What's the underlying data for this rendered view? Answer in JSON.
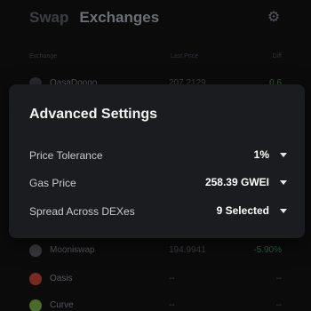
{
  "tabs": [
    {
      "label": "Swap"
    },
    {
      "label": "Exchanges"
    }
  ],
  "header": {
    "settings_icon": "gear-icon"
  },
  "table": {
    "columns": [
      "Exchange",
      "Last Price",
      "Diff"
    ],
    "rows": [
      {
        "name": "OasaDoogo",
        "price": "207.2129",
        "diff": "0.6",
        "logo_color": "#2b2c30"
      },
      {
        "name": "Mooniswap",
        "price": "194.9941",
        "diff": "-5.90%",
        "logo_color": "#3a3b40"
      },
      {
        "name": "Oasis",
        "price": "--",
        "diff": "--",
        "logo_color": "#7a2a20"
      },
      {
        "name": "Curve",
        "price": "--",
        "diff": "--",
        "logo_color": "#4a6b2a"
      }
    ]
  },
  "modal": {
    "title": "Advanced Settings",
    "settings": [
      {
        "label": "Price Tolerance",
        "value": "1%"
      },
      {
        "label": "Gas Price",
        "value": "258.39 GWEI"
      },
      {
        "label": "Spread Across DEXes",
        "value": "9 Selected"
      }
    ]
  }
}
